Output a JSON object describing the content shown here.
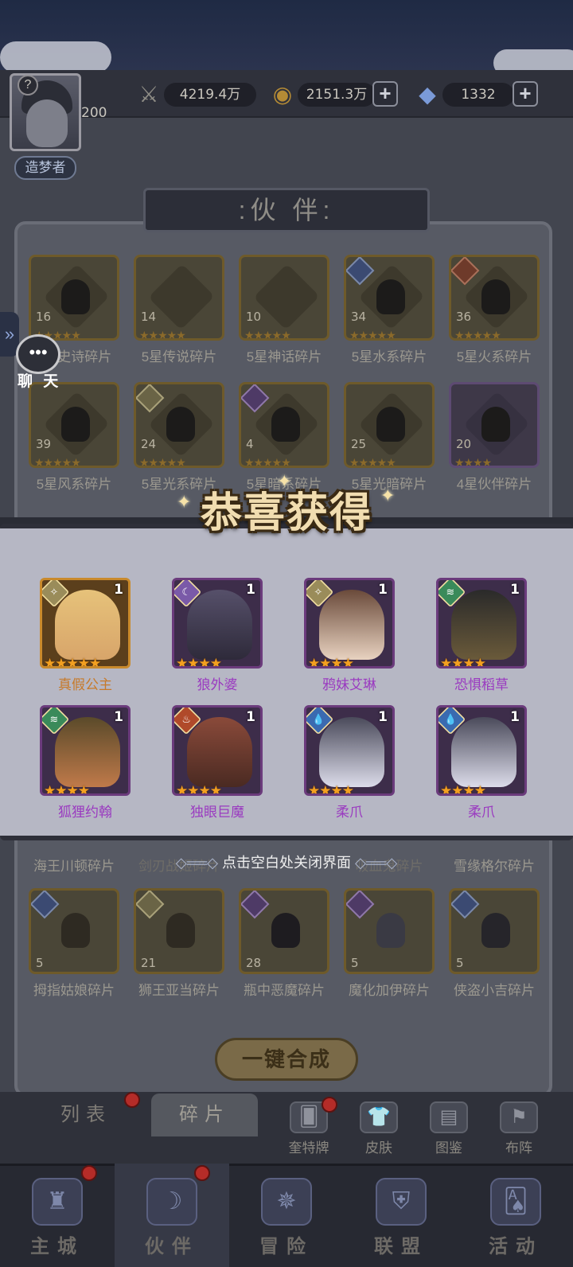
{
  "header": {
    "help_icon": "?",
    "player_level": "200",
    "player_title": "造梦者",
    "power": "4219.4万",
    "gold": "2151.3万",
    "diamonds": "1332",
    "plus": "+"
  },
  "panel": {
    "title": ":伙 伴:",
    "fragments_row1": [
      {
        "count": "16",
        "label": "5星史诗碎片"
      },
      {
        "count": "14",
        "label": "5星传说碎片"
      },
      {
        "count": "10",
        "label": "5星神话碎片"
      },
      {
        "count": "34",
        "label": "5星水系碎片"
      },
      {
        "count": "36",
        "label": "5星火系碎片"
      }
    ],
    "fragments_row2": [
      {
        "count": "39",
        "label": "5星风系碎片"
      },
      {
        "count": "24",
        "label": "5星光系碎片"
      },
      {
        "count": "4",
        "label": "5星暗系碎片"
      },
      {
        "count": "25",
        "label": "5星光暗碎片"
      },
      {
        "count": "20",
        "label": "4星伙伴碎片"
      }
    ],
    "fragments_row4_labels": [
      "海王川顿碎片",
      "剑刃战姬碎片",
      "",
      "吸血鬼碎片",
      "雪缘格尔碎片"
    ],
    "fragments_row5": [
      {
        "count": "5",
        "label": "拇指姑娘碎片"
      },
      {
        "count": "21",
        "label": "狮王亚当碎片"
      },
      {
        "count": "28",
        "label": "瓶中恶魔碎片"
      },
      {
        "count": "5",
        "label": "魔化加伊碎片"
      },
      {
        "count": "5",
        "label": "侠盗小吉碎片"
      }
    ],
    "merge_button": "一键合成"
  },
  "chat": {
    "tab_icon": "»",
    "bubble_icon": "•••",
    "label": "聊 天"
  },
  "modal": {
    "title": "恭喜获得",
    "close_hint": "点击空白处关闭界面",
    "rewards": [
      {
        "name": "真假公主",
        "qty": "1",
        "stars": "★★★★★",
        "rarity": "gold",
        "element": "light"
      },
      {
        "name": "狼外婆",
        "qty": "1",
        "stars": "★★★★",
        "rarity": "purple",
        "element": "dark"
      },
      {
        "name": "鸦妹艾琳",
        "qty": "1",
        "stars": "★★★★",
        "rarity": "purple",
        "element": "light"
      },
      {
        "name": "恐惧稻草",
        "qty": "1",
        "stars": "★★★★",
        "rarity": "purple",
        "element": "wind"
      },
      {
        "name": "狐狸约翰",
        "qty": "1",
        "stars": "★★★★",
        "rarity": "purple",
        "element": "wind"
      },
      {
        "name": "独眼巨魔",
        "qty": "1",
        "stars": "★★★★",
        "rarity": "purple",
        "element": "fire"
      },
      {
        "name": "柔爪",
        "qty": "1",
        "stars": "★★★★",
        "rarity": "purple",
        "element": "water"
      },
      {
        "name": "柔爪",
        "qty": "1",
        "stars": "★★★★",
        "rarity": "purple",
        "element": "water"
      }
    ]
  },
  "subtabs": {
    "list": "列表",
    "fragments": "碎片"
  },
  "functions": [
    {
      "label": "奎特牌",
      "icon": "card-icon"
    },
    {
      "label": "皮肤",
      "icon": "skin-icon"
    },
    {
      "label": "图鉴",
      "icon": "codex-icon"
    },
    {
      "label": "布阵",
      "icon": "formation-icon"
    }
  ],
  "bottom_nav": [
    {
      "label": "主城",
      "icon": "castle-icon"
    },
    {
      "label": "伙伴",
      "icon": "partner-icon"
    },
    {
      "label": "冒险",
      "icon": "adventure-icon"
    },
    {
      "label": "联盟",
      "icon": "alliance-icon"
    },
    {
      "label": "活动",
      "icon": "event-icon"
    }
  ],
  "colors": {
    "gold_name": "#c77a2a",
    "purple_name": "#9a3ac0",
    "star": "#f3a020"
  }
}
